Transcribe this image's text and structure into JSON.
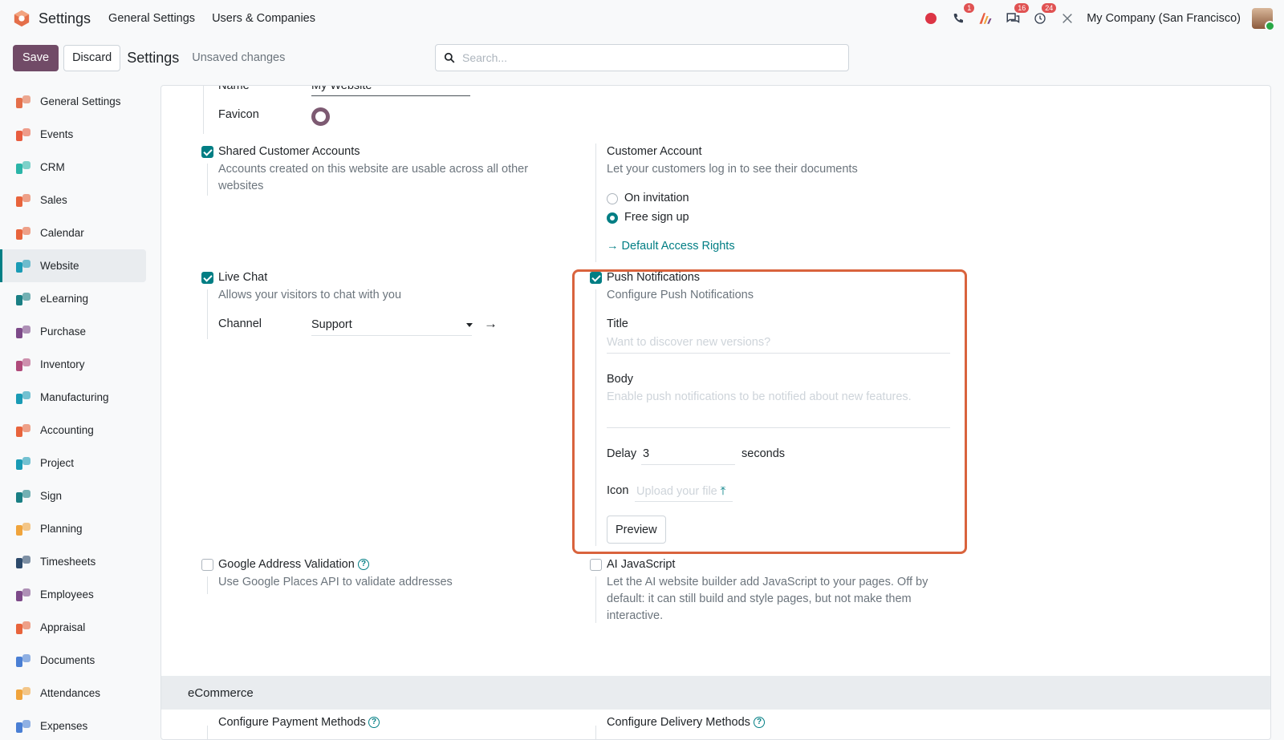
{
  "navbar": {
    "app_name": "Settings",
    "menu": [
      "General Settings",
      "Users & Companies"
    ],
    "badges": {
      "phone": "1",
      "chat": "16",
      "activity": "24"
    },
    "company": "My Company (San Francisco)"
  },
  "control": {
    "save": "Save",
    "discard": "Discard",
    "breadcrumb": "Settings",
    "status": "Unsaved changes",
    "search_placeholder": "Search..."
  },
  "sidebar": {
    "items": [
      {
        "label": "General Settings",
        "icon": "settings-icon",
        "color": "#e46f4a"
      },
      {
        "label": "Events",
        "icon": "events-icon",
        "color": "#e85d3f"
      },
      {
        "label": "CRM",
        "icon": "crm-icon",
        "color": "#2bb5a8"
      },
      {
        "label": "Sales",
        "icon": "sales-icon",
        "color": "#e8643c"
      },
      {
        "label": "Calendar",
        "icon": "calendar-icon",
        "color": "#e8643c"
      },
      {
        "label": "Website",
        "icon": "website-icon",
        "color": "#1a9bb5"
      },
      {
        "label": "eLearning",
        "icon": "elearning-icon",
        "color": "#1a7f84"
      },
      {
        "label": "Purchase",
        "icon": "purchase-icon",
        "color": "#7d4a89"
      },
      {
        "label": "Inventory",
        "icon": "inventory-icon",
        "color": "#b04a7a"
      },
      {
        "label": "Manufacturing",
        "icon": "manufacturing-icon",
        "color": "#1a9bb5"
      },
      {
        "label": "Accounting",
        "icon": "accounting-icon",
        "color": "#e8643c"
      },
      {
        "label": "Project",
        "icon": "project-icon",
        "color": "#1a9bb5"
      },
      {
        "label": "Sign",
        "icon": "sign-icon",
        "color": "#1a7f84"
      },
      {
        "label": "Planning",
        "icon": "planning-icon",
        "color": "#f0a43c"
      },
      {
        "label": "Timesheets",
        "icon": "timesheets-icon",
        "color": "#2d4a6b"
      },
      {
        "label": "Employees",
        "icon": "employees-icon",
        "color": "#7d4a89"
      },
      {
        "label": "Appraisal",
        "icon": "appraisal-icon",
        "color": "#e8643c"
      },
      {
        "label": "Documents",
        "icon": "documents-icon",
        "color": "#4a7fd4"
      },
      {
        "label": "Attendances",
        "icon": "attendances-icon",
        "color": "#f0a43c"
      },
      {
        "label": "Expenses",
        "icon": "expenses-icon",
        "color": "#4a7fd4"
      }
    ],
    "active_index": 5
  },
  "form": {
    "name_label": "Name",
    "name_value": "My Website",
    "favicon_label": "Favicon",
    "shared_accounts": {
      "title": "Shared Customer Accounts",
      "desc": "Accounts created on this website are usable across all other websites",
      "checked": true
    },
    "customer_account": {
      "title": "Customer Account",
      "desc": "Let your customers log in to see their documents",
      "options": [
        "On invitation",
        "Free sign up"
      ],
      "selected": "Free sign up",
      "link": "Default Access Rights"
    },
    "live_chat": {
      "title": "Live Chat",
      "desc": "Allows your visitors to chat with you",
      "checked": true,
      "channel_label": "Channel",
      "channel_value": "Support"
    },
    "push": {
      "title": "Push Notifications",
      "desc": "Configure Push Notifications",
      "checked": true,
      "title_label": "Title",
      "title_placeholder": "Want to discover new versions?",
      "body_label": "Body",
      "body_placeholder": "Enable push notifications to be notified about new features.",
      "delay_label": "Delay",
      "delay_value": "3",
      "delay_unit": "seconds",
      "icon_label": "Icon",
      "icon_placeholder": "Upload your file",
      "preview": "Preview"
    },
    "google_address": {
      "title": "Google Address Validation",
      "desc": "Use Google Places API to validate addresses",
      "checked": false
    },
    "ai_js": {
      "title": "AI JavaScript",
      "desc": "Let the AI website builder add JavaScript to your pages. Off by default: it can still build and style pages, but not make them interactive.",
      "checked": false
    },
    "section_ecommerce": "eCommerce",
    "payment_methods": "Configure Payment Methods",
    "delivery_methods": "Configure Delivery Methods"
  }
}
